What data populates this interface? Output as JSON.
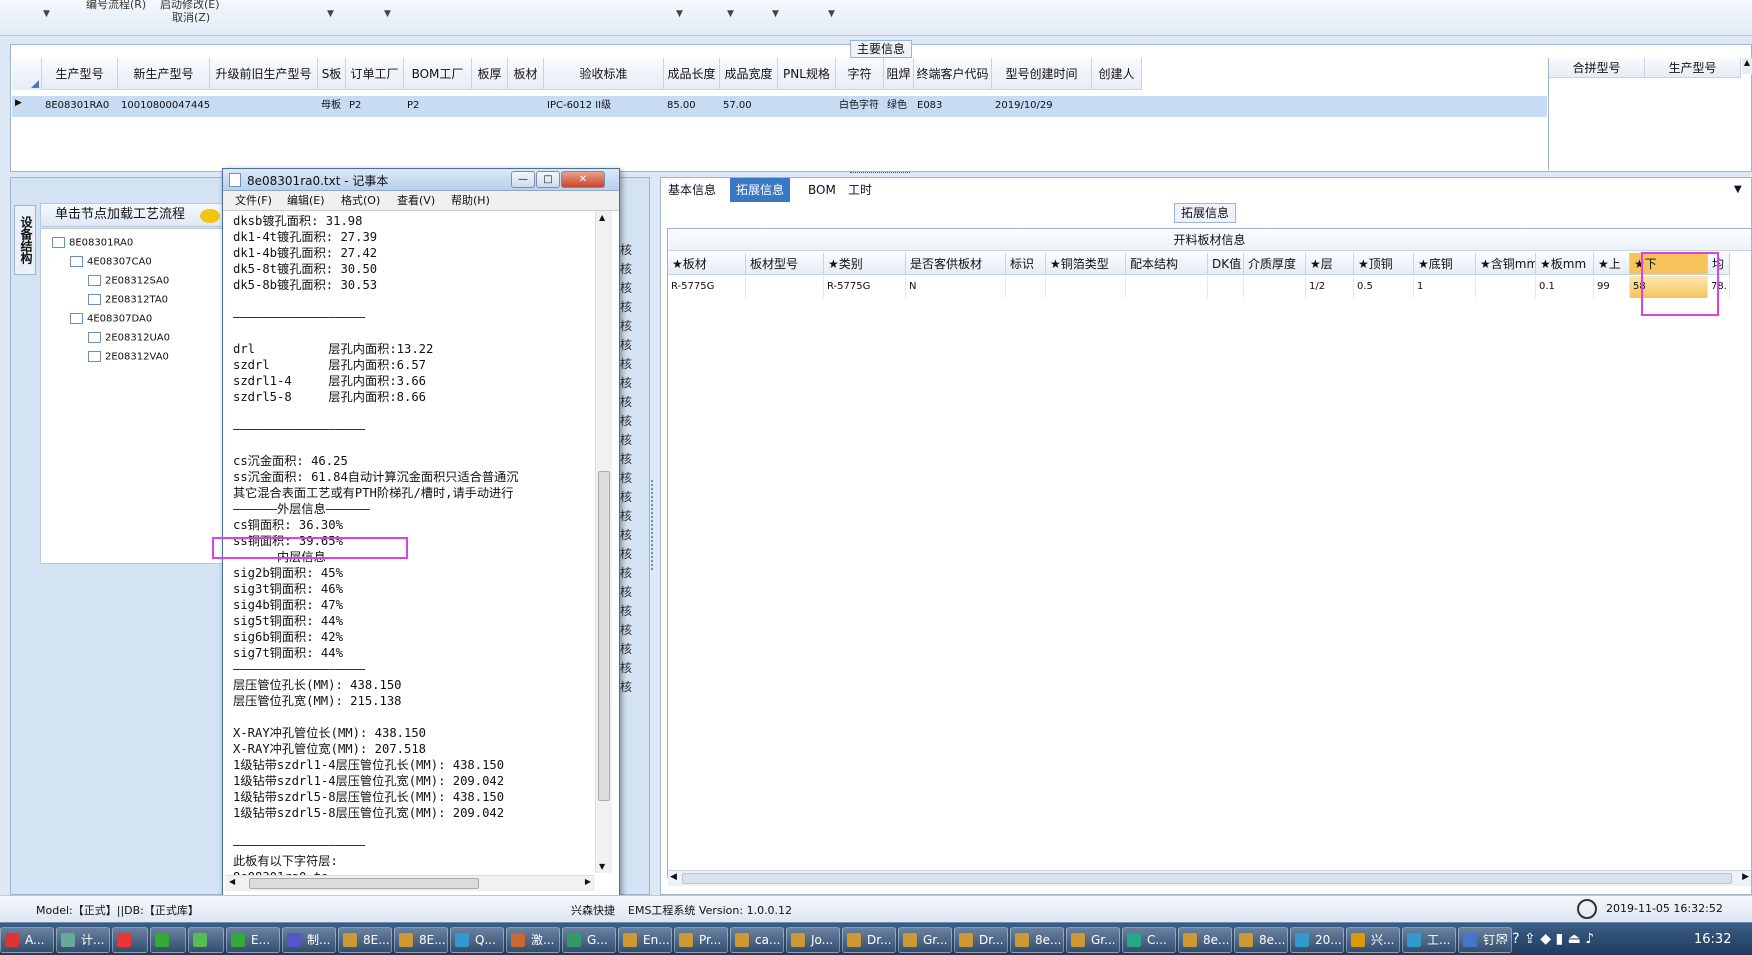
{
  "toolbar": {
    "item1": "编号流程(R)",
    "item2": "启动修改(E)",
    "cancel": "取消(Z)"
  },
  "main_info": {
    "title": "主要信息",
    "columns": [
      "生产型号",
      "新生产型号",
      "升级前旧生产型号",
      "S板",
      "订单工厂",
      "BOM工厂",
      "板厚",
      "板材",
      "验收标准",
      "成品长度",
      "成品宽度",
      "PNL规格",
      "字符",
      "阻焊",
      "终端客户代码",
      "型号创建时间",
      "创建人"
    ],
    "row": [
      "8E08301RA0",
      "10010800047445",
      "",
      "母板",
      "P2",
      "P2",
      "",
      "",
      "IPC-6012 II级",
      "85.00",
      "57.00",
      "",
      "白色字符",
      "绿色",
      "E083",
      "2019/10/29",
      ""
    ],
    "right_columns": [
      "合拼型号",
      "生产型号"
    ]
  },
  "left_panel": {
    "header": "单击节点加载工艺流程",
    "side_tab": "设备结构",
    "tree": [
      {
        "label": "8E08301RA0",
        "level": 0
      },
      {
        "label": "4E08307CA0",
        "level": 1
      },
      {
        "label": "2E08312SA0",
        "level": 2
      },
      {
        "label": "2E08312TA0",
        "level": 2
      },
      {
        "label": "4E08307DA0",
        "level": 1
      },
      {
        "label": "2E08312UA0",
        "level": 2
      },
      {
        "label": "2E08312VA0",
        "level": 2
      }
    ],
    "right_column_items": [
      "核",
      "核",
      "核",
      "核",
      "核",
      "核",
      "核",
      "核",
      "核",
      "核",
      "核",
      "核",
      "核",
      "核",
      "核",
      "核",
      "核",
      "核",
      "核",
      "核",
      "核",
      "核",
      "核",
      "核"
    ]
  },
  "notepad": {
    "title": "8e08301ra0.txt - 记事本",
    "menu": [
      "文件(F)",
      "编辑(E)",
      "格式(O)",
      "查看(V)",
      "帮助(H)"
    ],
    "lines": [
      "dksb镀孔面积: 31.98",
      "dk1-4t镀孔面积: 27.39",
      "dk1-4b镀孔面积: 27.42",
      "dk5-8t镀孔面积: 30.50",
      "dk5-8b镀孔面积: 30.53",
      "",
      "——————————————————",
      "",
      "drl          层孔内面积:13.22",
      "szdrl        层孔内面积:6.57",
      "szdrl1-4     层孔内面积:3.66",
      "szdrl5-8     层孔内面积:8.66",
      "",
      "——————————————————",
      "",
      "cs沉金面积: 46.25",
      "ss沉金面积: 61.84自动计算沉金面积只适合普通沉",
      "其它混合表面工艺或有PTH阶梯孔/槽时,请手动进行",
      "——————外层信息——————",
      "cs铜面积: 36.30%",
      "ss铜面积: 39.65%",
      "——————内层信息——————",
      "sig2b铜面积: 45%",
      "sig3t铜面积: 46%",
      "sig4b铜面积: 47%",
      "sig5t铜面积: 44%",
      "sig6b铜面积: 42%",
      "sig7t铜面积: 44%",
      "——————————————————",
      "层压管位孔长(MM): 438.150",
      "层压管位孔宽(MM): 215.138",
      "",
      "X-RAY冲孔管位长(MM): 438.150",
      "X-RAY冲孔管位宽(MM): 207.518",
      "1级钻带szdrl1-4层压管位孔长(MM): 438.150",
      "1级钻带szdrl1-4层压管位孔宽(MM): 209.042",
      "1级钻带szdrl5-8层压管位孔长(MM): 438.150",
      "1级钻带szdrl5-8层压管位孔宽(MM): 209.042",
      "",
      "——————————————————",
      "此板有以下字符层:",
      "8e08301ra0.to",
      "——————————————————"
    ]
  },
  "right_panel": {
    "tabs": [
      "基本信息",
      "拓展信息",
      "BOM",
      "工时"
    ],
    "active_tab": "拓展信息",
    "section_title": "拓展信息",
    "grid_title": "开料板材信息",
    "columns": [
      "★板材",
      "板材型号",
      "★类别",
      "是否客供板材",
      "标识",
      "★铜箔类型",
      "配本结构",
      "DK值",
      "介质厚度",
      "★层",
      "★顶铜",
      "★底铜",
      "★含铜mm",
      "★板mm",
      "★上",
      "★下",
      "均"
    ],
    "row": [
      "R-5775G",
      "",
      "R-5775G",
      "N",
      "",
      "",
      "",
      "",
      "",
      "1/2",
      "0.5",
      "1",
      "",
      "0.1",
      "99",
      "58",
      "78."
    ]
  },
  "statusbar": {
    "model": "Model:【正式】||DB:【正式库】",
    "company": "兴森快捷",
    "app": "EMS工程系统  Version: 1.0.0.12",
    "datetime": "2019-11-05 16:32:52"
  },
  "taskbar": {
    "items": [
      "A...",
      "计...",
      "",
      "",
      "",
      "E...",
      "制...",
      "8E...",
      "8E...",
      "Q...",
      "激...",
      "G...",
      "En...",
      "Pr...",
      "ca...",
      "Jo...",
      "Dr...",
      "Gr...",
      "Dr...",
      "8e...",
      "Gr...",
      "C...",
      "8e...",
      "8e...",
      "20...",
      "兴...",
      "工...",
      "钉..."
    ],
    "clock": "16:32"
  },
  "colors": {
    "highlight_box": "#e040e0",
    "selected_cell": "#f7c35a",
    "active_tab": "#3a78c4"
  }
}
